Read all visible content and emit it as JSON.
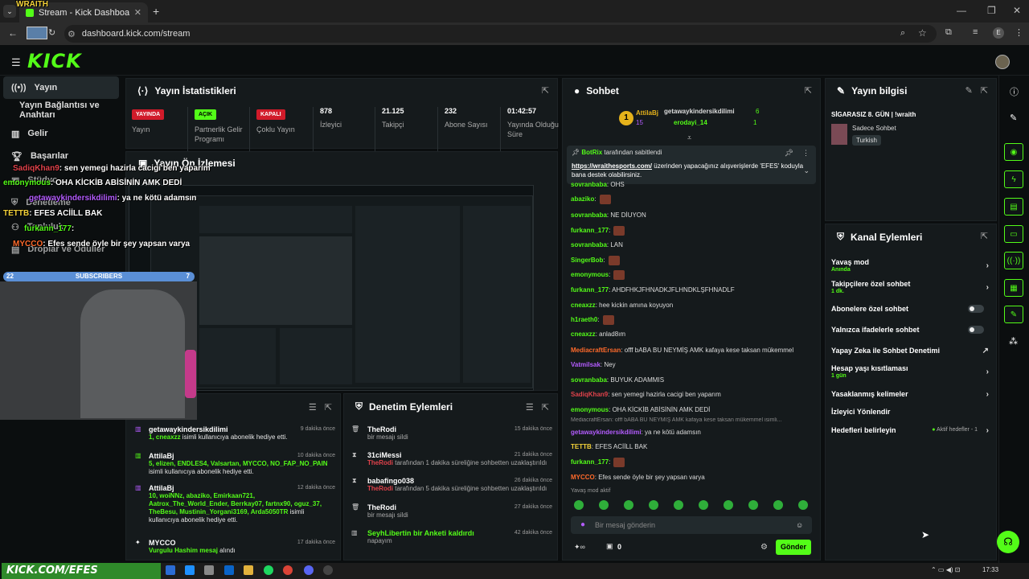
{
  "browser": {
    "tab_title": "Stream - Kick Dashboard",
    "url": "dashboard.kick.com/stream",
    "profile_initial": "E"
  },
  "overlay": {
    "channel_name": "WRAITH",
    "subscribers_label": "SUBSCRIBERS",
    "subscribers_left": "22",
    "subscribers_right": "7",
    "bottom_banner": "KICK.COM/EFES",
    "chat": [
      {
        "user": "SadiqKhan9",
        "text": ": sen yemegi hazirla cacigi ben yaparim",
        "color": "#e0424b"
      },
      {
        "user": "emonymous",
        "text": ": OHA KİCKİB ABİSİNİN AMK DEDİ",
        "color": "#53fc18"
      },
      {
        "user": "getawaykindersikdilimi",
        "text": ": ya ne kötü adamsın",
        "color": "#b45cff"
      },
      {
        "user": "TETTB",
        "text": ": EFES ACİİLL BAK",
        "color": "#f5d33a"
      },
      {
        "user": "furkann_177",
        "text": ":",
        "color": "#53fc18"
      },
      {
        "user": "MYCCO",
        "text": ": Efes sende öyle bir şey yapsan varya",
        "color": "#ff6a2b"
      }
    ]
  },
  "kick": {
    "logo": "KICK",
    "sidebar": [
      {
        "label": "Yayın"
      },
      {
        "label": "Yayın Bağlantısı ve Anahtarı"
      },
      {
        "label": "Gelir"
      },
      {
        "label": "Başarılar"
      },
      {
        "label": "Stüdyo"
      },
      {
        "label": "Denetleme"
      },
      {
        "label": "Topluluk"
      },
      {
        "label": "Droplar ve Ödüller"
      }
    ]
  },
  "stats": {
    "title": "Yayın İstatistikleri",
    "items": [
      {
        "value": "YAYINDA",
        "label": "Yayın"
      },
      {
        "value": "AÇIK",
        "label": "Partnerlik Gelir Programı"
      },
      {
        "value": "KAPALI",
        "label": "Çoklu Yayın"
      },
      {
        "value": "878",
        "label": "İzleyici"
      },
      {
        "value": "21.125",
        "label": "Takipçi"
      },
      {
        "value": "232",
        "label": "Abone Sayısı"
      },
      {
        "value": "01:42:57",
        "label": "Yayında Olduğu Süre"
      }
    ]
  },
  "preview": {
    "title": "Yayın Ön İzlemesi"
  },
  "events": {
    "items": [
      {
        "name": "getawaykindersikdilimi",
        "time": "9 dakika önce",
        "green": "1, cneaxzz",
        "text": " isimli kullanıcıya abonelik hediye etti."
      },
      {
        "name": "AttilaBj",
        "time": "10 dakika önce",
        "green": "5, elizen, ENDLES4, Valsartan, MYCCO, NO_FAP_NO_PAIN",
        "text": " isimli kullanıcıya abonelik hediye etti."
      },
      {
        "name": "AttilaBj",
        "time": "12 dakika önce",
        "green": "10, woiNNz, abaziko, Emirkaan721, Aatrox_The_World_Ender, Berrkay07, fartnx90, oguz_37, TheBesu, Mustinin_Yorgani3169, Arda5050TR",
        "text": " isimli kullanıcıya abonelik hediye etti."
      },
      {
        "name": "MYCCO",
        "time": "17 dakika önce",
        "green": "Vurgulu Hashim mesaj",
        "text": " alındı"
      }
    ]
  },
  "moderation": {
    "title": "Denetim Eylemleri",
    "items": [
      {
        "name": "TheRodi",
        "time": "15 dakika önce",
        "sub": "bir mesajı sildi"
      },
      {
        "name": "31ciMessi",
        "time": "21 dakika önce",
        "sub": "tarafından 1 dakika süreliğine sohbetten uzaklaştırıldı",
        "target": "TheRodi"
      },
      {
        "name": "babafingo038",
        "time": "26 dakika önce",
        "sub": "tarafından 5 dakika süreliğine sohbetten uzaklaştırıldı",
        "target": "TheRodi"
      },
      {
        "name": "TheRodi",
        "time": "27 dakika önce",
        "sub": "bir mesajı sildi"
      },
      {
        "name": "SeyhLibertin bir Anketi kaldırdı",
        "time": "42 dakika önce",
        "sub": "napayım"
      }
    ]
  },
  "chat": {
    "title": "Sohbet",
    "top_gifters": [
      {
        "rank": "1",
        "name": "AttilaBj",
        "count": "15"
      },
      {
        "rank": "",
        "name": "getawaykindersikdilimi",
        "count": "6"
      },
      {
        "rank": "",
        "name": "erodayi_14",
        "count": "1"
      }
    ],
    "pinned_by": "BotRix",
    "pinned_label": "tarafından sabitlendi",
    "pinned_link": "https://wraithesports.com/",
    "pinned_text": " üzerinden yapacağınız alışverişlerde 'EFES' koduyla bana destek olabilirsiniz.",
    "messages": [
      {
        "user": "sovranbaba",
        "text": ": OHS",
        "color": "#53fc18"
      },
      {
        "user": "abaziko",
        "text": ":",
        "color": "#53fc18"
      },
      {
        "user": "sovranbaba",
        "text": ": NE DİUYON",
        "color": "#53fc18"
      },
      {
        "user": "furkann_177",
        "text": ":",
        "color": "#53fc18"
      },
      {
        "user": "sovranbaba",
        "text": ": LAN",
        "color": "#53fc18"
      },
      {
        "user": "SingerBob",
        "text": ":",
        "color": "#53fc18"
      },
      {
        "user": "emonymous",
        "text": ":",
        "color": "#53fc18"
      },
      {
        "user": "furkann_177",
        "text": ": AHDFHKJFHNADKJFLHNDKLŞFHNADLF",
        "color": "#53fc18"
      },
      {
        "user": "cneaxzz",
        "text": ": hee kickin amına koyuyon",
        "color": "#53fc18"
      },
      {
        "user": "h1raeth0",
        "text": ":",
        "color": "#53fc18"
      },
      {
        "user": "cneaxzz",
        "text": ": anlad8ım",
        "color": "#53fc18"
      },
      {
        "user": "MediacraftErsan",
        "text": ": offf bABA BU NEYMİŞ AMK kafaya kese taksan mükemmel",
        "color": "#ff6a2b"
      },
      {
        "user": "Vatmilsak",
        "text": ": Ney",
        "color": "#b45cff"
      },
      {
        "user": "sovranbaba",
        "text": ": BUYUK ADAMMIS",
        "color": "#53fc18"
      },
      {
        "user": "SadiqKhan9",
        "text": ": sen yemegi hazirla cacigi ben yaparım",
        "color": "#e0424b"
      },
      {
        "user": "emonymous",
        "text": ": OHA KİCKİB ABİSİNİN AMK DEDİ",
        "color": "#53fc18"
      },
      {
        "user": "getawaykindersikdilimi",
        "text": ": ya ne kötü adamsın",
        "color": "#b45cff"
      },
      {
        "user": "TETTB",
        "text": ": EFES ACİİLL BAK",
        "color": "#f5d33a"
      },
      {
        "user": "furkann_177",
        "text": ":",
        "color": "#53fc18"
      },
      {
        "user": "MYCCO",
        "text": ": Efes sende öyle bir şey yapsan varya",
        "color": "#ff6a2b"
      }
    ],
    "reply_preview": "MediacraftErsan: offf bABA BU NEYMİŞ AMK kafaya kese taksan mükemmel isimli...",
    "slow_mode": "Yavaş mod aktif",
    "input_placeholder": "Bir mesaj gönderin",
    "points": "0",
    "send_label": "Gönder"
  },
  "stream_info": {
    "title": "Yayın bilgisi",
    "stream_title": "SİGARASIZ 8. GÜN | !wraith",
    "category": "Sadece Sohbet",
    "language": "Turkish"
  },
  "channel_actions": {
    "title": "Kanal Eylemleri",
    "items": [
      {
        "label": "Yavaş mod",
        "sub": "Anında",
        "kind": "chevron"
      },
      {
        "label": "Takipçilere özel sohbet",
        "sub": "1 dk.",
        "kind": "chevron"
      },
      {
        "label": "Abonelere özel sohbet",
        "sub": "",
        "kind": "toggle"
      },
      {
        "label": "Yalnızca ifadelerle sohbet",
        "sub": "",
        "kind": "toggle"
      },
      {
        "label": "Yapay Zeka ile Sohbet Denetimi",
        "sub": "",
        "kind": "external"
      },
      {
        "label": "Hesap yaşı kısıtlaması",
        "sub": "1 gün",
        "kind": "chevron"
      },
      {
        "label": "Yasaklanmış kelimeler",
        "sub": "",
        "kind": "chevron"
      },
      {
        "label": "İzleyici Yönlendir",
        "sub": "",
        "kind": "none"
      },
      {
        "label": "Hedefleri belirleyin",
        "sub": "",
        "kind": "chevron",
        "note": "Aktif hedefler - 1"
      }
    ]
  },
  "taskbar": {
    "time": "17:33"
  },
  "colors": {
    "accent": "#53fc18",
    "live": "#d11b2a",
    "bg": "#0b0e0f",
    "panel": "#151a1c"
  }
}
